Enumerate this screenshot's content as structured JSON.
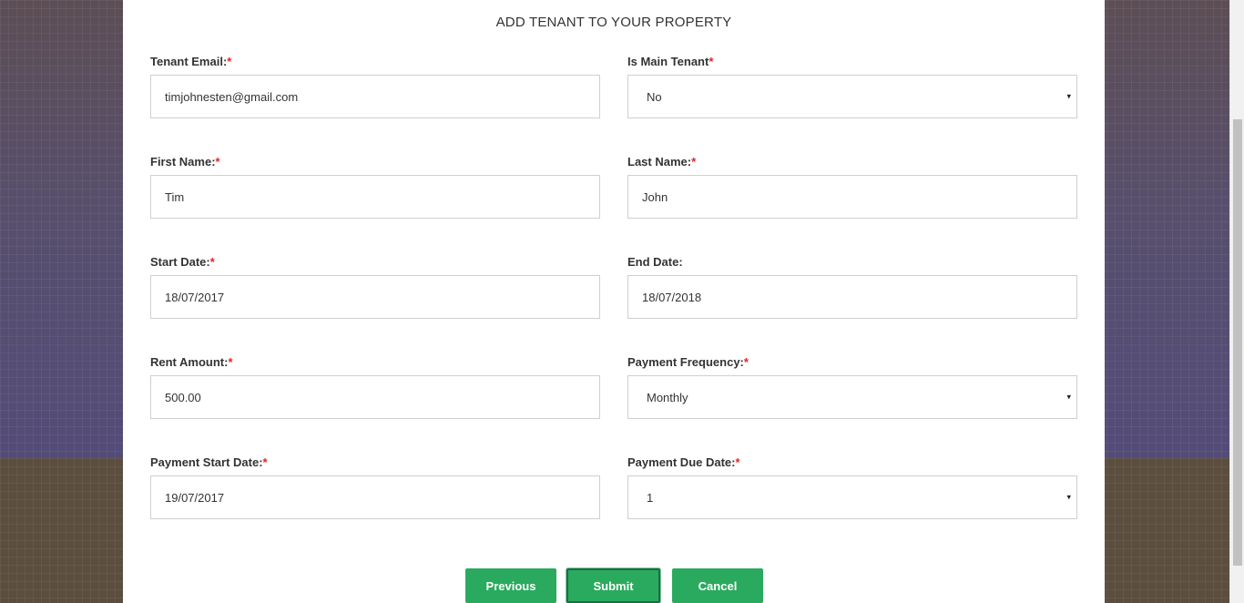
{
  "form": {
    "title": "ADD TENANT TO YOUR PROPERTY",
    "required_mark": "*",
    "fields": {
      "tenant_email": {
        "label": "Tenant Email:",
        "value": "timjohnesten@gmail.com"
      },
      "is_main_tenant": {
        "label": "Is Main Tenant",
        "value": "No"
      },
      "first_name": {
        "label": "First Name:",
        "value": "Tim"
      },
      "last_name": {
        "label": "Last Name:",
        "value": "John"
      },
      "start_date": {
        "label": "Start Date:",
        "value": "18/07/2017"
      },
      "end_date": {
        "label": "End Date:",
        "value": "18/07/2018"
      },
      "rent_amount": {
        "label": "Rent Amount:",
        "value": "500.00"
      },
      "payment_frequency": {
        "label": "Payment Frequency:",
        "value": "Monthly"
      },
      "payment_start_date": {
        "label": "Payment Start Date:",
        "value": "19/07/2017"
      },
      "payment_due_date": {
        "label": "Payment Due Date:",
        "value": "1"
      }
    },
    "buttons": {
      "previous": "Previous",
      "submit": "Submit",
      "cancel": "Cancel"
    }
  },
  "icons": {
    "select_caret": "▾"
  },
  "colors": {
    "button_green": "#2aaa5e",
    "required_red": "#e52424"
  }
}
